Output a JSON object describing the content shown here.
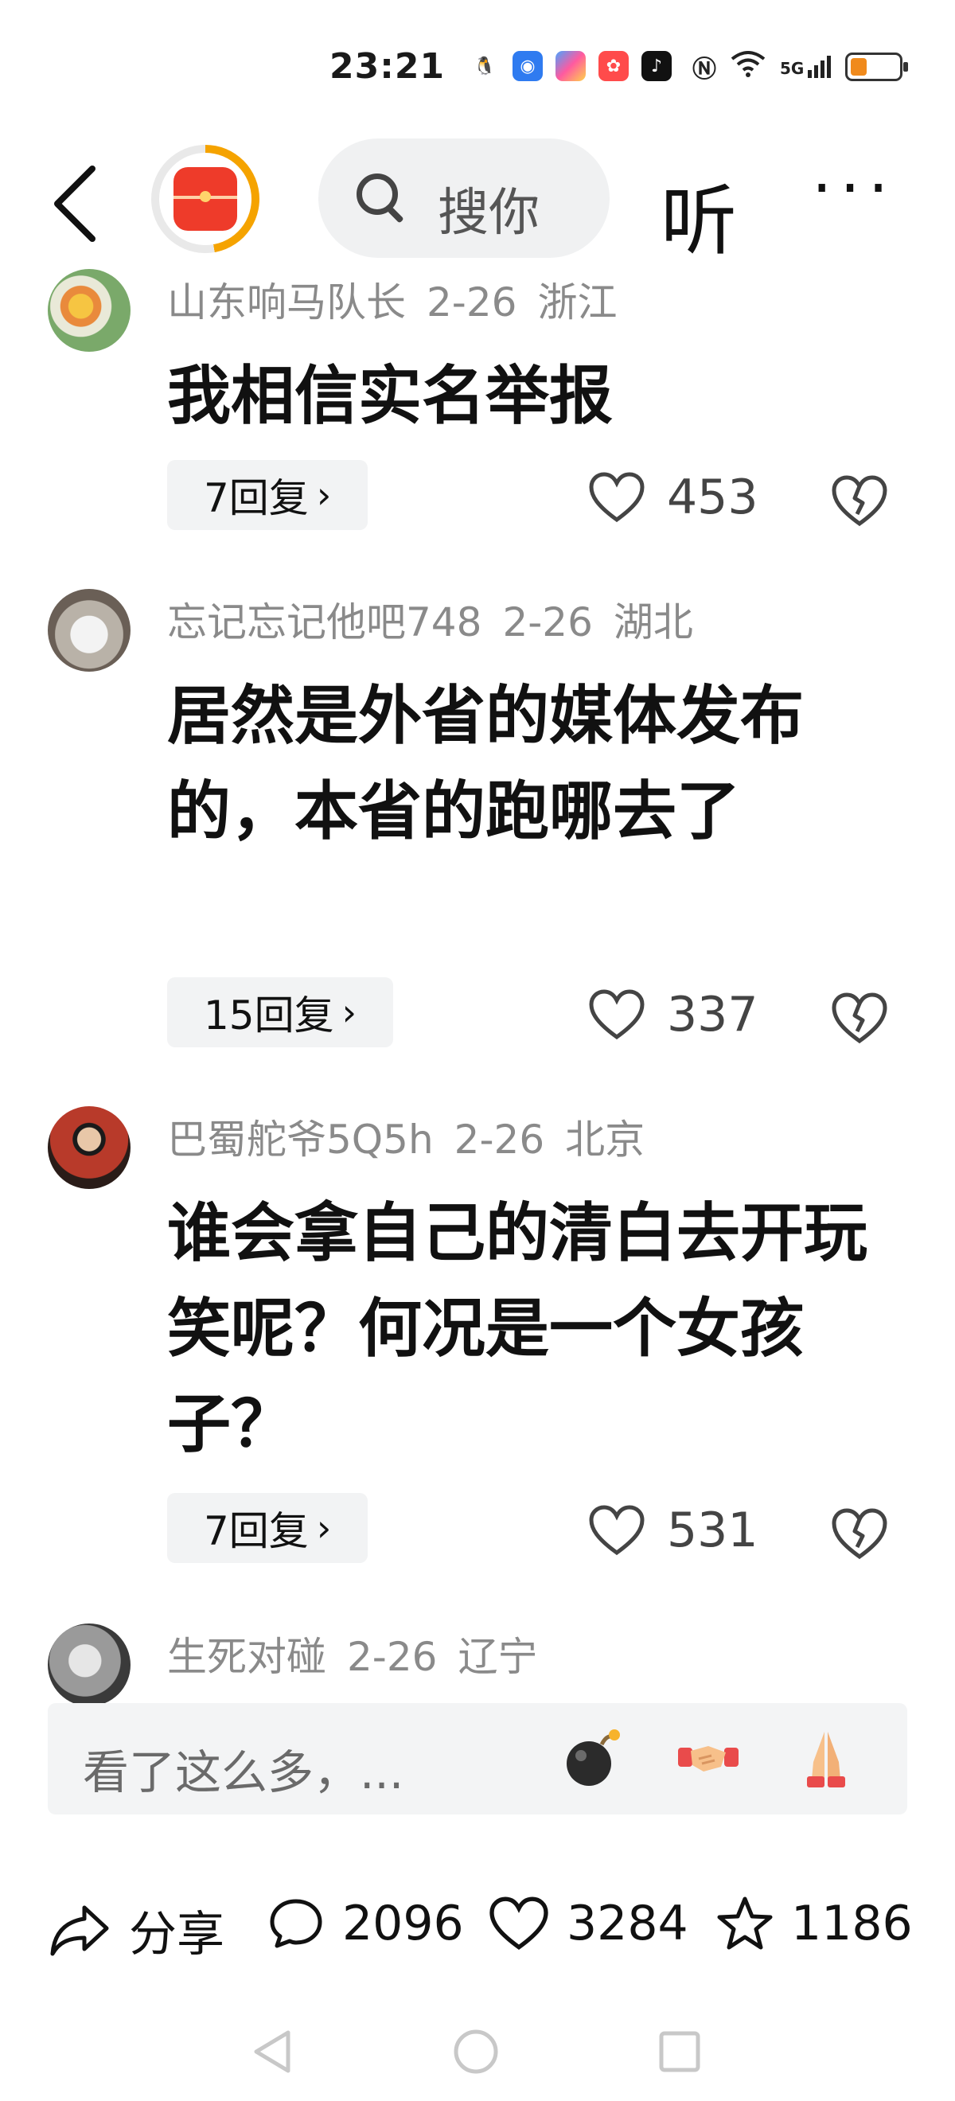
{
  "status_bar": {
    "time": "23:21",
    "network": "5G",
    "battery_level": 0.35
  },
  "nav": {
    "back_icon": "chevron-left-icon",
    "redpacket_icon": "red-packet-icon",
    "search_placeholder": "搜你",
    "listen_label": "听",
    "more_label": "···"
  },
  "comments": [
    {
      "user": "山东响马队长",
      "date": "2-26",
      "region": "浙江",
      "text": "我相信实名举报",
      "replies": "7回复",
      "likes": "453"
    },
    {
      "user": "忘记忘记他吧748",
      "date": "2-26",
      "region": "湖北",
      "text": "居然是外省的媒体发布的，本省的跑哪去了",
      "replies": "15回复",
      "likes": "337"
    },
    {
      "user": "巴蜀舵爷5Q5h",
      "date": "2-26",
      "region": "北京",
      "text": "谁会拿自己的清白去开玩笑呢？何况是一个女孩子？",
      "replies": "7回复",
      "likes": "531"
    },
    {
      "user": "生死对碰",
      "date": "2-26",
      "region": "辽宁"
    }
  ],
  "input_bar": {
    "hint": "看了这么多，...",
    "emojis": [
      "bomb-icon",
      "handshake-icon",
      "pray-icon"
    ]
  },
  "action_bar": {
    "share_label": "分享",
    "comment_count": "2096",
    "like_count": "3284",
    "favorite_count": "1186"
  },
  "system_nav": {
    "back": "triangle-back-icon",
    "home": "circle-home-icon",
    "recents": "square-recents-icon"
  }
}
